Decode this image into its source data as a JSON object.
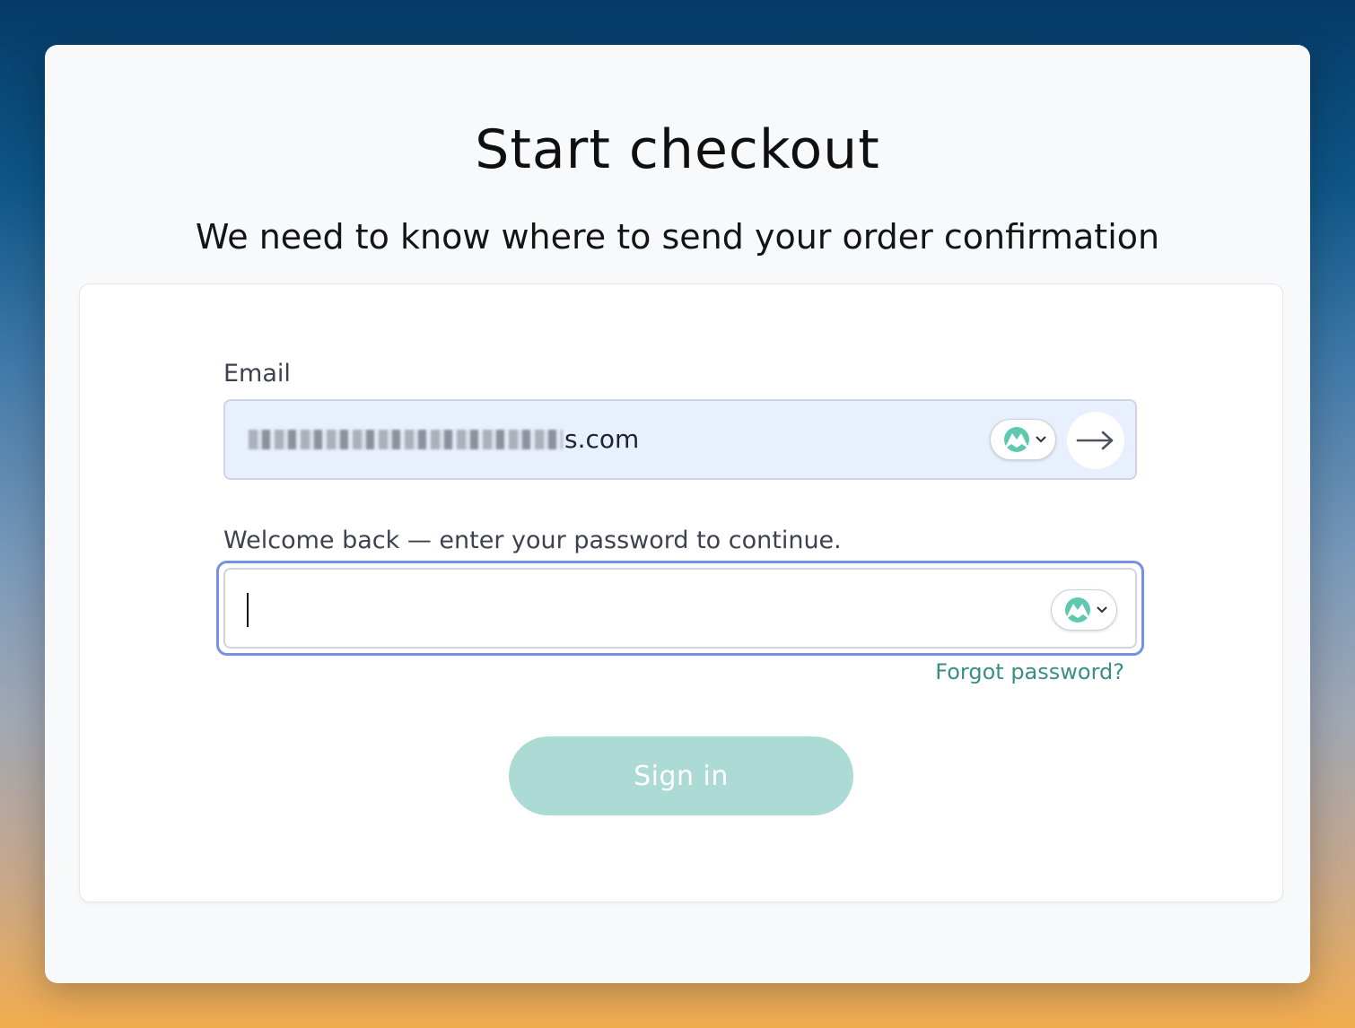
{
  "page": {
    "title": "Start checkout",
    "subtitle": "We need to know where to send your order confirmation"
  },
  "form": {
    "email_label": "Email",
    "email_value_visible": "s.com",
    "password_prompt": "Welcome back — enter your password to continue.",
    "password_value": "",
    "forgot_password": "Forgot password?",
    "sign_in": "Sign in"
  },
  "icons": {
    "password_manager": "mountain-logo-icon",
    "dropdown": "chevron-down-icon",
    "submit": "arrow-right-icon"
  },
  "colors": {
    "accent": "#3a8f84",
    "sign_in_button": "#acdbd6",
    "focus_ring": "#7590e4",
    "email_field_bg": "#e8effd",
    "logo": "#5ec8b0"
  }
}
